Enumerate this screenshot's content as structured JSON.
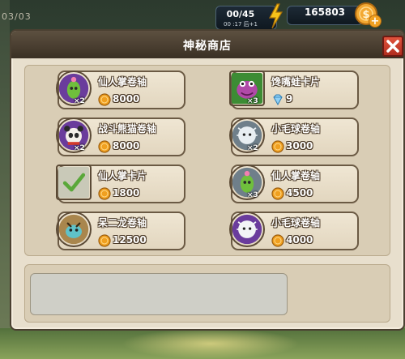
{
  "level_label": "03/03",
  "hud": {
    "energy": "00/45",
    "energy_timer": "00 :17 后+1",
    "gold": "165803"
  },
  "shop": {
    "title": "神秘商店",
    "items": [
      {
        "name": "仙人掌卷轴",
        "qty": "×2",
        "price": "8000",
        "currency": "gold-coin",
        "icon": "cactus-scroll-icon"
      },
      {
        "name": "馋嘴蛙卡片",
        "qty": "×3",
        "price": "9",
        "currency": "diamond",
        "icon": "frog-card-icon"
      },
      {
        "name": "战斗熊猫卷轴",
        "qty": "×2",
        "price": "8000",
        "currency": "gold-coin",
        "icon": "panda-scroll-icon"
      },
      {
        "name": "小毛球卷轴",
        "qty": "×2",
        "price": "3000",
        "currency": "gold-coin",
        "icon": "furball-scroll-icon"
      },
      {
        "name": "仙人掌卡片",
        "qty": "",
        "price": "1800",
        "currency": "gold-coin",
        "icon": "checkmark-card-icon"
      },
      {
        "name": "仙人掌卷轴",
        "qty": "×3",
        "price": "4500",
        "currency": "gold-coin",
        "icon": "cactus-scroll-icon"
      },
      {
        "name": "呆二龙卷轴",
        "qty": "",
        "price": "12500",
        "currency": "gold-coin",
        "icon": "dragon-scroll-icon"
      },
      {
        "name": "小毛球卷轴",
        "qty": "",
        "price": "4000",
        "currency": "gold-coin",
        "icon": "furball-scroll-icon"
      }
    ]
  },
  "colors": {
    "panel_bg": "#e8dfcd",
    "header_bg": "#4b4031",
    "close_red": "#c9392a",
    "coin_gold": "#f0a020",
    "diamond_blue": "#7fc4f0"
  }
}
